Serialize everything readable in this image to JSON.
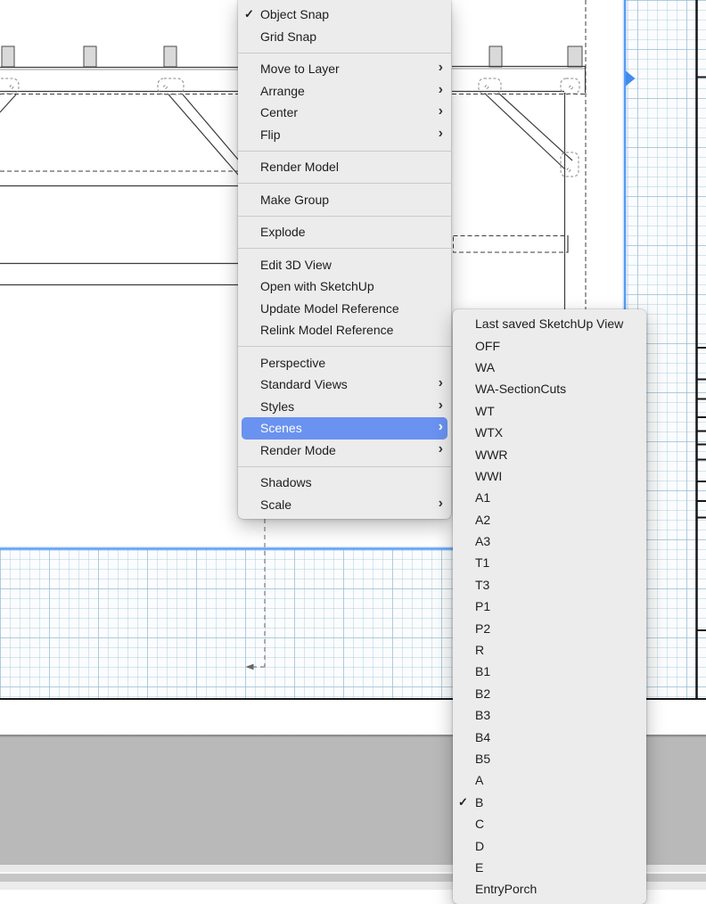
{
  "context_menu": {
    "items": [
      {
        "label": "Object Snap",
        "checked": true
      },
      {
        "label": "Grid Snap"
      },
      {
        "separator": true
      },
      {
        "label": "Move to Layer",
        "submenu": true
      },
      {
        "label": "Arrange",
        "submenu": true
      },
      {
        "label": "Center",
        "submenu": true
      },
      {
        "label": "Flip",
        "submenu": true
      },
      {
        "separator": true
      },
      {
        "label": "Render Model"
      },
      {
        "separator": true
      },
      {
        "label": "Make Group"
      },
      {
        "separator": true
      },
      {
        "label": "Explode"
      },
      {
        "separator": true
      },
      {
        "label": "Edit 3D View"
      },
      {
        "label": "Open with SketchUp"
      },
      {
        "label": "Update Model Reference"
      },
      {
        "label": "Relink Model Reference"
      },
      {
        "separator": true
      },
      {
        "label": "Perspective"
      },
      {
        "label": "Standard Views",
        "submenu": true
      },
      {
        "label": "Styles",
        "submenu": true
      },
      {
        "label": "Scenes",
        "submenu": true,
        "highlighted": true
      },
      {
        "label": "Render Mode",
        "submenu": true
      },
      {
        "separator": true
      },
      {
        "label": "Shadows"
      },
      {
        "label": "Scale",
        "submenu": true
      }
    ]
  },
  "scenes_submenu": {
    "items": [
      {
        "label": "Last saved SketchUp View"
      },
      {
        "label": "OFF"
      },
      {
        "label": "WA"
      },
      {
        "label": "WA-SectionCuts"
      },
      {
        "label": "WT"
      },
      {
        "label": "WTX"
      },
      {
        "label": "WWR"
      },
      {
        "label": "WWI"
      },
      {
        "label": "A1"
      },
      {
        "label": "A2"
      },
      {
        "label": "A3"
      },
      {
        "label": "T1"
      },
      {
        "label": "T3"
      },
      {
        "label": "P1"
      },
      {
        "label": "P2"
      },
      {
        "label": "R"
      },
      {
        "label": "B1"
      },
      {
        "label": "B2"
      },
      {
        "label": "B3"
      },
      {
        "label": "B4"
      },
      {
        "label": "B5"
      },
      {
        "label": "A"
      },
      {
        "label": "B",
        "checked": true
      },
      {
        "label": "C"
      },
      {
        "label": "D"
      },
      {
        "label": "E"
      },
      {
        "label": "EntryPorch"
      }
    ]
  },
  "glyphs": {
    "checkmark": "✓",
    "chevron": "›"
  },
  "colors": {
    "menu_bg": "#ececec",
    "menu_text": "#1d1d1f",
    "separator": "rgba(0,0,0,0.14)",
    "highlight_bg": "#6a92f0",
    "highlight_text": "#ffffff",
    "selection_blue": "#579bf5",
    "selection_glow": "rgba(120,175,245,0.35)",
    "handle_blue": "#418bee",
    "grid_minor": "rgba(176,206,223,0.50)",
    "grid_major": "rgba(146,183,204,0.55)",
    "paper": "#fbfcfd",
    "viewport_white": "#ffffff",
    "line_dark": "#3c3c3c",
    "line_black": "#161616",
    "desk_gray": "#b9b9b9"
  }
}
